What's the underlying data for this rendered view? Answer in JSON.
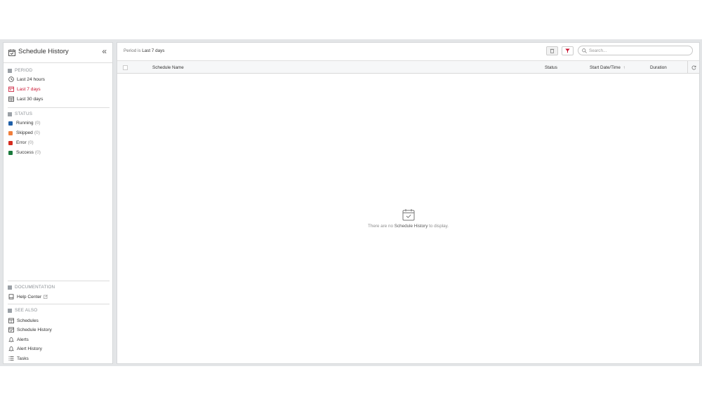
{
  "sidebar": {
    "title": "Schedule History",
    "collapse_glyph": "«",
    "period": {
      "heading": "PERIOD",
      "items": [
        {
          "label": "Last 24 hours",
          "icon": "clock-icon"
        },
        {
          "label": "Last 7 days",
          "icon": "calendar-week-icon",
          "active": true
        },
        {
          "label": "Last 30 days",
          "icon": "calendar-month-icon"
        }
      ]
    },
    "status": {
      "heading": "STATUS",
      "items": [
        {
          "label": "Running",
          "count": "(0)",
          "color": "#1f5fa8"
        },
        {
          "label": "Skipped",
          "count": "(0)",
          "color": "#f07e3c"
        },
        {
          "label": "Error",
          "count": "(0)",
          "color": "#d52b1e"
        },
        {
          "label": "Success",
          "count": "(0)",
          "color": "#1a7a3c"
        }
      ]
    },
    "documentation": {
      "heading": "DOCUMENTATION",
      "items": [
        {
          "label": "Help Center"
        }
      ]
    },
    "see_also": {
      "heading": "SEE ALSO",
      "items": [
        {
          "label": "Schedules"
        },
        {
          "label": "Schedule History"
        },
        {
          "label": "Alerts"
        },
        {
          "label": "Alert History"
        },
        {
          "label": "Tasks"
        }
      ]
    }
  },
  "toolbar": {
    "period_prefix": "Period is",
    "period_value": "Last 7 days",
    "search_placeholder": "Search..."
  },
  "table": {
    "columns": {
      "name": "Schedule Name",
      "status": "Status",
      "start": "Start Date/Time",
      "sort_glyph": "↑",
      "duration": "Duration"
    }
  },
  "empty_state": {
    "prefix": "There are no",
    "highlight": "Schedule History",
    "suffix": "to display."
  },
  "colors": {
    "accent": "#c8102e",
    "frame": "#e3e5e7"
  }
}
